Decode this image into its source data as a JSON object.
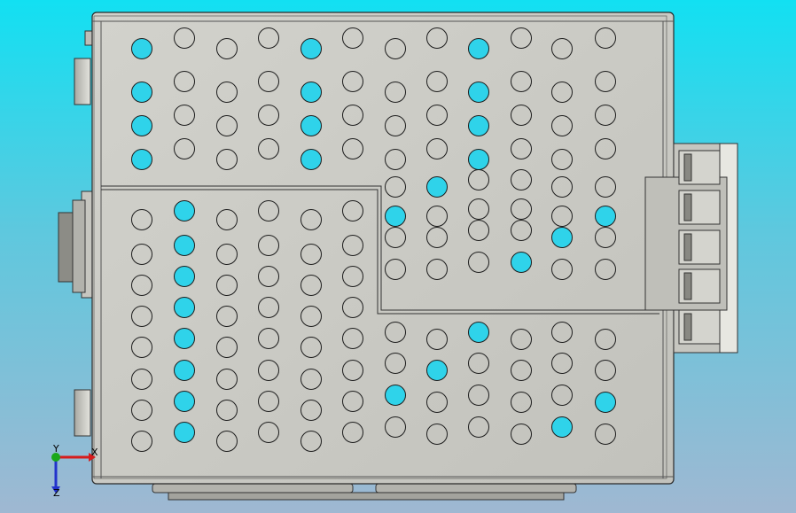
{
  "viewport": {
    "background_top": "#12e0f2",
    "background_bottom": "#9fb8d2"
  },
  "model": {
    "part_face_color": "#c9c9c3",
    "part_edge_color": "#2a2a2a",
    "hole_cutout_color": "#2fd3ea",
    "description_icon": "perforated-enclosure-top-view"
  },
  "triad": {
    "x_label": "X",
    "y_label": "Y",
    "z_label": "Z",
    "x_color": "#d61c1c",
    "y_color": "#1aa81a",
    "z_color": "#2233cc"
  }
}
